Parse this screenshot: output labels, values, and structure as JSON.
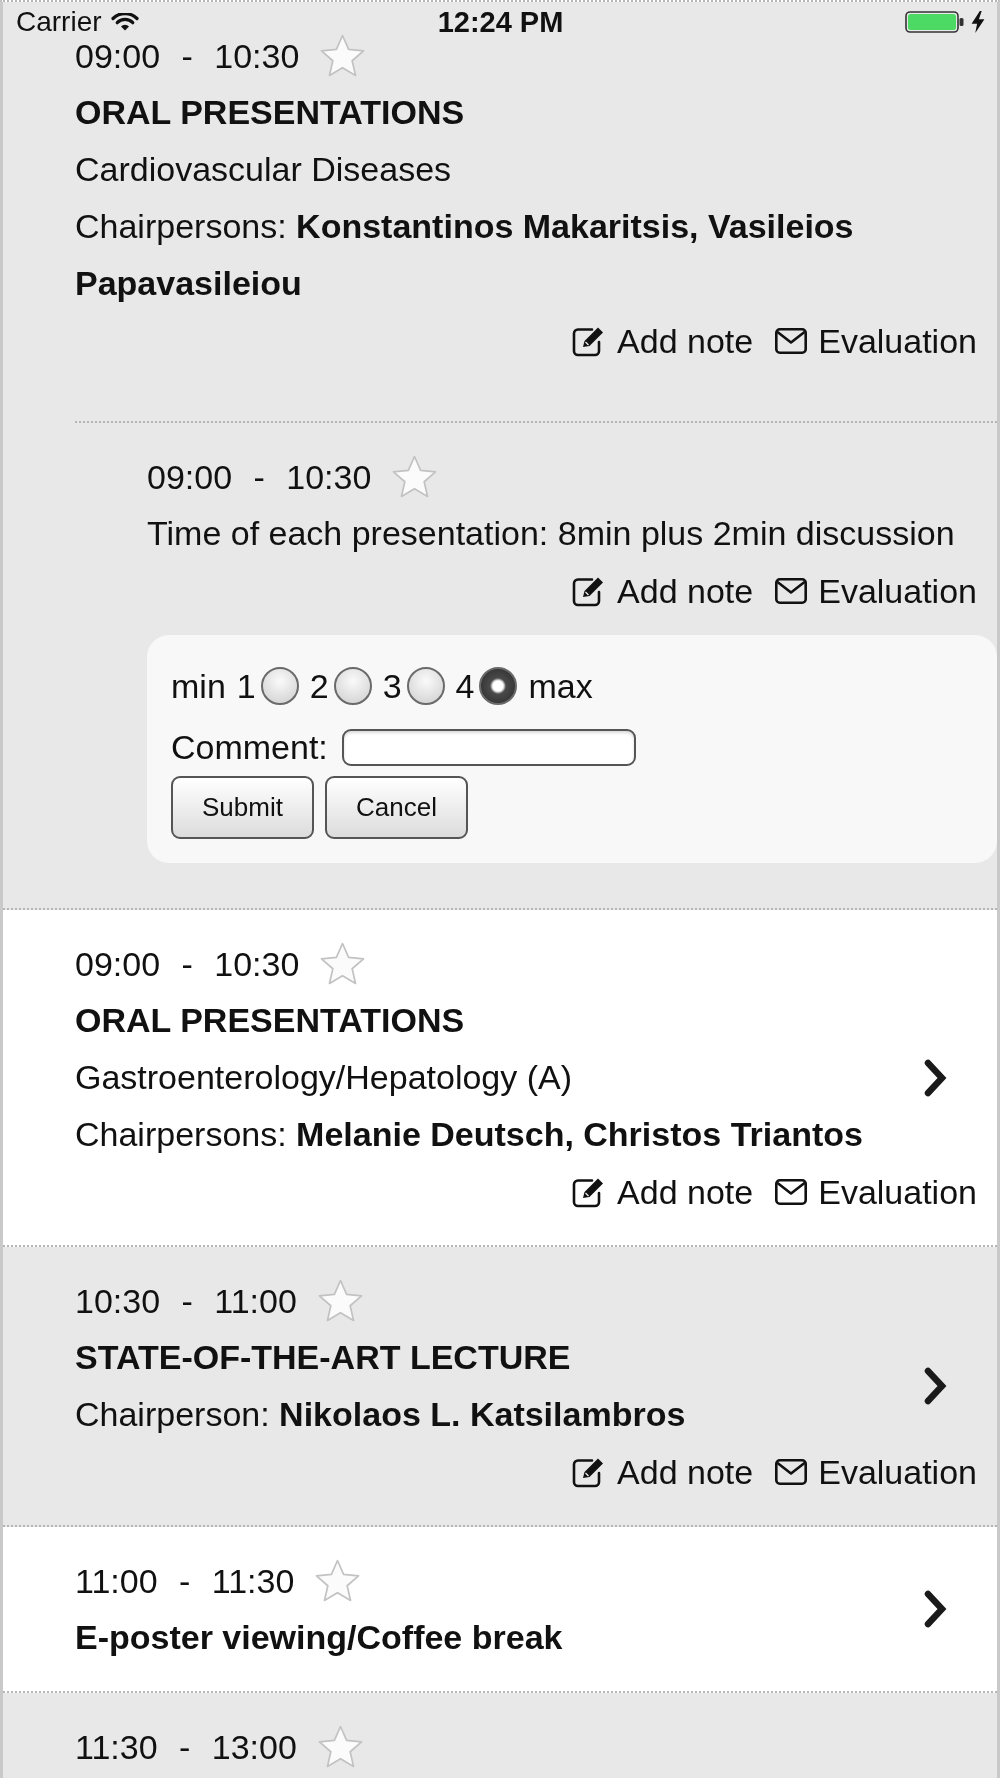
{
  "status_bar": {
    "carrier": "Carrier",
    "time": "12:24 PM"
  },
  "sessions": [
    {
      "time": "09:00 - 10:30",
      "starred": false,
      "title": "ORAL PRESENTATIONS",
      "topic": "Cardiovascular Diseases",
      "chairs": "Chairpersons: **Konstantinos Makaritsis, Vasileios Papavasileiou**",
      "has_details": false,
      "actions": [
        {
          "kind": "note",
          "label": "Add note"
        },
        {
          "kind": "evaluation",
          "label": "Evaluation"
        }
      ],
      "children": [
        {
          "time": "09:00 - 10:30",
          "starred": false,
          "description": "Time of each presentation: 8min plus 2min discussion",
          "actions": [
            {
              "kind": "note",
              "label": "Add note"
            },
            {
              "kind": "evaluation",
              "label": "Evaluation"
            }
          ],
          "evaluation_form": {
            "min_label": "min",
            "options": [
              {
                "label": "1",
                "selected": false
              },
              {
                "label": "2",
                "selected": false
              },
              {
                "label": "3",
                "selected": false
              },
              {
                "label": "4",
                "selected": true
              }
            ],
            "max_label": "max",
            "comment_label": "Comment:",
            "buttons": [
              "Submit",
              "Cancel"
            ]
          }
        }
      ]
    },
    {
      "time": "09:00 - 10:30",
      "starred": false,
      "title": "ORAL PRESENTATIONS",
      "topic": "Gastroenterology/Hepatology (A)",
      "chairs": "Chairpersons: **Melanie Deutsch, Christos Triantos**",
      "has_details": true,
      "actions": [
        {
          "kind": "note",
          "label": "Add note"
        },
        {
          "kind": "evaluation",
          "label": "Evaluation"
        }
      ]
    },
    {
      "time": "10:30 - 11:00",
      "starred": false,
      "title": "STATE-OF-THE-ART LECTURE",
      "chairs": "Chairperson: **Nikolaos L. Katsilambros**",
      "has_details": true,
      "actions": [
        {
          "kind": "note",
          "label": "Add note"
        },
        {
          "kind": "evaluation",
          "label": "Evaluation"
        }
      ]
    },
    {
      "time": "11:00 - 11:30",
      "starred": false,
      "title": "E-poster viewing/Coffee break",
      "has_details": true
    },
    {
      "time": "11:30 - 13:00",
      "starred": false,
      "has_details": false
    }
  ]
}
